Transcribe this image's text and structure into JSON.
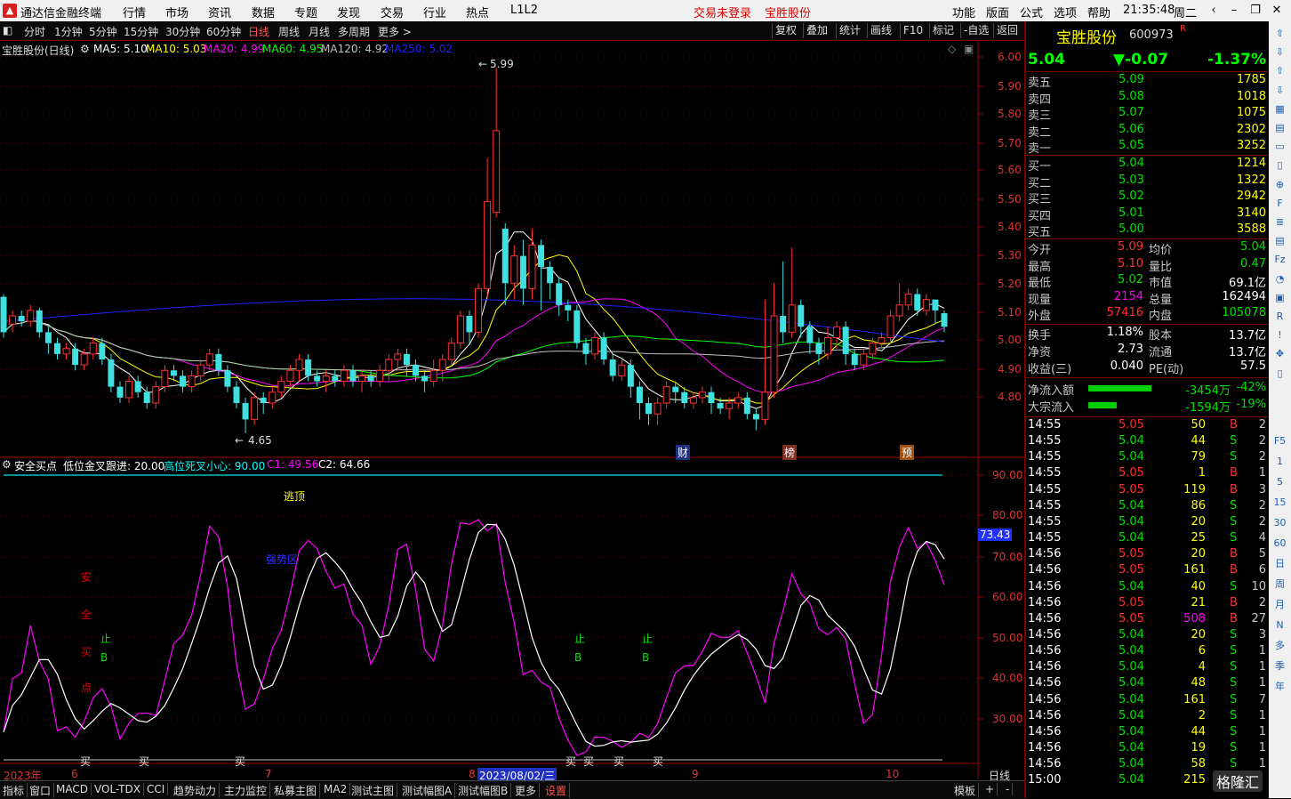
{
  "titlebar": {
    "app": "通达信金融终端",
    "menu": [
      "行情",
      "市场",
      "资讯",
      "数据",
      "专题",
      "发现",
      "交易",
      "行业",
      "热点",
      "L1L2"
    ],
    "status_red": "交易未登录",
    "status_stock": "宝胜股份",
    "right_menu": [
      "功能",
      "版面",
      "公式",
      "选项",
      "帮助"
    ],
    "time": "21:35:48",
    "weekday": "周二"
  },
  "toolbar": {
    "periods": [
      "分时",
      "1分钟",
      "5分钟",
      "15分钟",
      "30分钟",
      "60分钟",
      "日线",
      "周线",
      "月线",
      "多周期",
      "更多 >"
    ],
    "active_period": "日线",
    "right_buttons": [
      "复权",
      "叠加",
      "统计",
      "画线",
      "F10",
      "标记",
      "-自选",
      "返回"
    ]
  },
  "main_chart": {
    "title": "宝胜股份(日线)",
    "ma_legend": [
      {
        "label": "MA5: 5.10",
        "color": "#ffffff"
      },
      {
        "label": "MA10: 5.03",
        "color": "#ffff00"
      },
      {
        "label": "MA20: 4.99",
        "color": "#ff00ff"
      },
      {
        "label": "MA60: 4.95",
        "color": "#00ff00"
      },
      {
        "label": "MA120: 4.92",
        "color": "#c0c0c0"
      },
      {
        "label": "MA250: 5.02",
        "color": "#2020ff"
      }
    ],
    "high_label": "5.99",
    "low_label": "4.65",
    "y_ticks": [
      "6.00",
      "5.90",
      "5.80",
      "5.70",
      "5.60",
      "5.50",
      "5.40",
      "5.30",
      "5.20",
      "5.10",
      "5.00",
      "4.90",
      "4.80"
    ],
    "event_markers": [
      "财",
      "榜",
      "预"
    ]
  },
  "indicator": {
    "name": "安全买点",
    "params": [
      {
        "label": "低位金叉跟进: 20.00",
        "color": "#ffffff"
      },
      {
        "label": "高位死叉小心: 90.00",
        "color": "#00ffff"
      },
      {
        "label": "C1: 49.56",
        "color": "#ff00ff"
      },
      {
        "label": "C2: 64.66",
        "color": "#ffffff"
      }
    ],
    "y_ticks": [
      "90.00",
      "80.00",
      "70.00",
      "60.00",
      "50.00",
      "40.00",
      "30.00"
    ],
    "current_value": "73.43",
    "top_label": "逃顶",
    "blue_label": "强势区",
    "vertical_label": [
      "安",
      "全",
      "买",
      "点"
    ],
    "stop_labels": [
      "止",
      "止",
      "止"
    ],
    "b_label": "B",
    "buy_label": "买"
  },
  "x_axis": {
    "labels": [
      "2023年",
      "6",
      "7",
      "8",
      "2023/08/02/三",
      "9",
      "10"
    ],
    "period_label": "日线"
  },
  "bottom_tabs": [
    "指标",
    "窗口",
    "MACD",
    "VOL-TDX",
    "CCI",
    "趋势动力",
    "主力监控",
    "私募主图",
    "MA2",
    "测试主图",
    "测试幅图A",
    "测试幅图B",
    "更多",
    "设置"
  ],
  "bottom_right": [
    "模板",
    "+",
    "-"
  ],
  "quote": {
    "name": "宝胜股份",
    "code": "600973",
    "suffix": "R",
    "price": "5.04",
    "change": "▼-0.07",
    "change_pct": "-1.37%",
    "asks": [
      {
        "label": "卖五",
        "price": "5.09",
        "vol": "1785"
      },
      {
        "label": "卖四",
        "price": "5.08",
        "vol": "1018"
      },
      {
        "label": "卖三",
        "price": "5.07",
        "vol": "1075"
      },
      {
        "label": "卖二",
        "price": "5.06",
        "vol": "2302"
      },
      {
        "label": "卖一",
        "price": "5.05",
        "vol": "3252"
      }
    ],
    "bids": [
      {
        "label": "买一",
        "price": "5.04",
        "vol": "1214"
      },
      {
        "label": "买二",
        "price": "5.03",
        "vol": "1322"
      },
      {
        "label": "买三",
        "price": "5.02",
        "vol": "2942"
      },
      {
        "label": "买四",
        "price": "5.01",
        "vol": "3140"
      },
      {
        "label": "买五",
        "price": "5.00",
        "vol": "3588"
      }
    ],
    "stats": [
      {
        "l1": "今开",
        "v1": "5.09",
        "c1": "#ff3030",
        "l2": "均价",
        "v2": "5.04",
        "c2": "#00e000"
      },
      {
        "l1": "最高",
        "v1": "5.10",
        "c1": "#ff3030",
        "l2": "量比",
        "v2": "0.47",
        "c2": "#00e000"
      },
      {
        "l1": "最低",
        "v1": "5.02",
        "c1": "#00e000",
        "l2": "市值",
        "v2": "69.1亿",
        "c2": "#ffffff"
      },
      {
        "l1": "现量",
        "v1": "2154",
        "c1": "#ff00ff",
        "l2": "总量",
        "v2": "162494",
        "c2": "#ffffff"
      },
      {
        "l1": "外盘",
        "v1": "57416",
        "c1": "#ff3030",
        "l2": "内盘",
        "v2": "105078",
        "c2": "#00e000"
      }
    ],
    "fin": [
      {
        "l1": "换手",
        "v1": "1.18%",
        "l2": "股本",
        "v2": "13.7亿"
      },
      {
        "l1": "净资",
        "v1": "2.73",
        "l2": "流通",
        "v2": "13.7亿"
      },
      {
        "l1": "收益(三)",
        "v1": "0.040",
        "l2": "PE(动)",
        "v2": "57.5"
      }
    ],
    "flows": [
      {
        "label": "净流入额",
        "value": "-3454万",
        "pct": "-42%",
        "bar": 0.42
      },
      {
        "label": "大宗流入",
        "value": "-1594万",
        "pct": "-19%",
        "bar": 0.19
      }
    ],
    "ticks": [
      {
        "t": "14:55",
        "p": "5.05",
        "v": "50",
        "bs": "B",
        "n": "2"
      },
      {
        "t": "14:55",
        "p": "5.04",
        "v": "44",
        "bs": "S",
        "n": "2"
      },
      {
        "t": "14:55",
        "p": "5.04",
        "v": "79",
        "bs": "S",
        "n": "2"
      },
      {
        "t": "14:55",
        "p": "5.05",
        "v": "1",
        "bs": "B",
        "n": "1"
      },
      {
        "t": "14:55",
        "p": "5.05",
        "v": "119",
        "bs": "B",
        "n": "3"
      },
      {
        "t": "14:55",
        "p": "5.04",
        "v": "86",
        "bs": "S",
        "n": "2"
      },
      {
        "t": "14:55",
        "p": "5.04",
        "v": "20",
        "bs": "S",
        "n": "2"
      },
      {
        "t": "14:55",
        "p": "5.04",
        "v": "25",
        "bs": "S",
        "n": "4"
      },
      {
        "t": "14:56",
        "p": "5.05",
        "v": "20",
        "bs": "B",
        "n": "5"
      },
      {
        "t": "14:56",
        "p": "5.05",
        "v": "161",
        "bs": "B",
        "n": "6"
      },
      {
        "t": "14:56",
        "p": "5.04",
        "v": "40",
        "bs": "S",
        "n": "10"
      },
      {
        "t": "14:56",
        "p": "5.05",
        "v": "21",
        "bs": "B",
        "n": "2"
      },
      {
        "t": "14:56",
        "p": "5.05",
        "v": "508",
        "bs": "B",
        "n": "27"
      },
      {
        "t": "14:56",
        "p": "5.04",
        "v": "20",
        "bs": "S",
        "n": "3"
      },
      {
        "t": "14:56",
        "p": "5.04",
        "v": "6",
        "bs": "S",
        "n": "1"
      },
      {
        "t": "14:56",
        "p": "5.04",
        "v": "4",
        "bs": "S",
        "n": "1"
      },
      {
        "t": "14:56",
        "p": "5.04",
        "v": "48",
        "bs": "S",
        "n": "1"
      },
      {
        "t": "14:56",
        "p": "5.04",
        "v": "161",
        "bs": "S",
        "n": "7"
      },
      {
        "t": "14:56",
        "p": "5.04",
        "v": "2",
        "bs": "S",
        "n": "1"
      },
      {
        "t": "14:56",
        "p": "5.04",
        "v": "44",
        "bs": "S",
        "n": "1"
      },
      {
        "t": "14:56",
        "p": "5.04",
        "v": "19",
        "bs": "S",
        "n": "1"
      },
      {
        "t": "14:56",
        "p": "5.04",
        "v": "58",
        "bs": "S",
        "n": "1"
      },
      {
        "t": "15:00",
        "p": "5.04",
        "v": "215",
        "bs": "",
        "n": ""
      }
    ],
    "watermark": "格隆汇"
  },
  "sidebar_icons": [
    "arrow-up-icon",
    "arrow-down-icon",
    "arrow-up2-icon",
    "arrow-down2-icon",
    "chart-icon",
    "grid-icon",
    "line-icon",
    "candle-icon",
    "zoom-icon",
    "f10-icon",
    "list-icon",
    "book-icon",
    "fz-icon",
    "clock-icon",
    "box-icon",
    "rsi-icon",
    "alert-icon",
    "move-icon",
    "kline-icon"
  ],
  "sidebar_labels": [
    "F5",
    "1",
    "5",
    "15",
    "30",
    "60",
    "日",
    "周",
    "月",
    "N",
    "多",
    "季",
    "年"
  ],
  "chart_data": {
    "type": "candlestick",
    "price_range": [
      4.6,
      6.05
    ],
    "candles": [
      [
        5.15,
        5.02,
        5.16,
        5.0
      ],
      [
        5.05,
        5.08,
        5.1,
        5.02
      ],
      [
        5.08,
        5.06,
        5.1,
        5.04
      ],
      [
        5.06,
        5.1,
        5.12,
        5.04
      ],
      [
        5.1,
        5.02,
        5.11,
        5.0
      ],
      [
        5.02,
        4.98,
        5.04,
        4.94
      ],
      [
        4.98,
        4.94,
        5.0,
        4.92
      ],
      [
        4.94,
        4.96,
        4.98,
        4.92
      ],
      [
        4.96,
        4.9,
        4.98,
        4.88
      ],
      [
        4.9,
        4.94,
        4.96,
        4.88
      ],
      [
        4.94,
        4.98,
        5.0,
        4.92
      ],
      [
        4.98,
        4.92,
        5.0,
        4.9
      ],
      [
        4.92,
        4.82,
        4.94,
        4.8
      ],
      [
        4.82,
        4.78,
        4.84,
        4.76
      ],
      [
        4.78,
        4.84,
        4.86,
        4.76
      ],
      [
        4.84,
        4.8,
        4.86,
        4.78
      ],
      [
        4.8,
        4.76,
        4.82,
        4.74
      ],
      [
        4.76,
        4.82,
        4.84,
        4.74
      ],
      [
        4.82,
        4.88,
        4.9,
        4.8
      ],
      [
        4.88,
        4.86,
        4.9,
        4.84
      ],
      [
        4.86,
        4.82,
        4.88,
        4.8
      ],
      [
        4.82,
        4.86,
        4.88,
        4.8
      ],
      [
        4.86,
        4.9,
        4.92,
        4.84
      ],
      [
        4.9,
        4.94,
        4.96,
        4.88
      ],
      [
        4.94,
        4.88,
        4.96,
        4.86
      ],
      [
        4.88,
        4.82,
        4.9,
        4.8
      ],
      [
        4.82,
        4.76,
        4.84,
        4.74
      ],
      [
        4.76,
        4.7,
        4.78,
        4.65
      ],
      [
        4.7,
        4.78,
        4.8,
        4.68
      ],
      [
        4.78,
        4.76,
        4.8,
        4.72
      ],
      [
        4.76,
        4.8,
        4.82,
        4.74
      ],
      [
        4.8,
        4.84,
        4.86,
        4.78
      ],
      [
        4.84,
        4.88,
        4.9,
        4.82
      ],
      [
        4.88,
        4.92,
        4.94,
        4.84
      ],
      [
        4.92,
        4.86,
        4.94,
        4.84
      ],
      [
        4.86,
        4.84,
        4.88,
        4.82
      ],
      [
        4.84,
        4.86,
        4.88,
        4.8
      ],
      [
        4.86,
        4.84,
        4.88,
        4.82
      ],
      [
        4.84,
        4.88,
        4.9,
        4.82
      ],
      [
        4.88,
        4.84,
        4.9,
        4.82
      ],
      [
        4.84,
        4.86,
        4.88,
        4.8
      ],
      [
        4.86,
        4.84,
        4.88,
        4.82
      ],
      [
        4.84,
        4.88,
        4.9,
        4.82
      ],
      [
        4.88,
        4.92,
        4.94,
        4.84
      ],
      [
        4.92,
        4.94,
        4.96,
        4.88
      ],
      [
        4.94,
        4.9,
        4.96,
        4.86
      ],
      [
        4.9,
        4.86,
        4.92,
        4.84
      ],
      [
        4.86,
        4.84,
        4.88,
        4.8
      ],
      [
        4.84,
        4.88,
        4.92,
        4.82
      ],
      [
        4.88,
        4.92,
        4.94,
        4.84
      ],
      [
        4.92,
        4.98,
        5.0,
        4.9
      ],
      [
        4.98,
        5.08,
        5.1,
        4.96
      ],
      [
        5.08,
        5.02,
        5.1,
        4.98
      ],
      [
        5.02,
        5.18,
        5.2,
        5.0
      ],
      [
        5.18,
        5.5,
        5.66,
        5.15
      ],
      [
        5.46,
        5.76,
        5.99,
        5.44
      ],
      [
        5.4,
        5.2,
        5.42,
        5.12
      ],
      [
        5.2,
        5.3,
        5.34,
        5.14
      ],
      [
        5.3,
        5.18,
        5.36,
        5.12
      ],
      [
        5.18,
        5.34,
        5.4,
        5.14
      ],
      [
        5.34,
        5.26,
        5.36,
        5.1
      ],
      [
        5.26,
        5.2,
        5.28,
        5.14
      ],
      [
        5.2,
        5.12,
        5.22,
        5.08
      ],
      [
        5.12,
        5.1,
        5.14,
        5.06
      ],
      [
        5.1,
        4.98,
        5.12,
        4.96
      ],
      [
        4.98,
        4.94,
        5.0,
        4.9
      ],
      [
        4.94,
        5.0,
        5.02,
        4.92
      ],
      [
        5.0,
        4.92,
        5.02,
        4.9
      ],
      [
        4.92,
        4.86,
        4.94,
        4.84
      ],
      [
        4.86,
        4.9,
        4.92,
        4.84
      ],
      [
        4.9,
        4.82,
        4.92,
        4.78
      ],
      [
        4.82,
        4.76,
        4.84,
        4.7
      ],
      [
        4.76,
        4.72,
        4.78,
        4.68
      ],
      [
        4.72,
        4.76,
        4.78,
        4.68
      ],
      [
        4.76,
        4.82,
        4.84,
        4.74
      ],
      [
        4.82,
        4.8,
        4.84,
        4.76
      ],
      [
        4.8,
        4.76,
        4.82,
        4.74
      ],
      [
        4.76,
        4.78,
        4.8,
        4.74
      ],
      [
        4.78,
        4.8,
        4.82,
        4.76
      ],
      [
        4.8,
        4.76,
        4.82,
        4.72
      ],
      [
        4.76,
        4.74,
        4.78,
        4.72
      ],
      [
        4.74,
        4.76,
        4.78,
        4.7
      ],
      [
        4.76,
        4.78,
        4.8,
        4.74
      ],
      [
        4.78,
        4.72,
        4.8,
        4.7
      ],
      [
        4.72,
        4.7,
        4.74,
        4.66
      ],
      [
        4.7,
        4.8,
        5.14,
        4.68
      ],
      [
        4.8,
        5.08,
        5.2,
        4.78
      ],
      [
        5.08,
        5.02,
        5.28,
        4.98
      ],
      [
        5.02,
        5.12,
        5.33,
        5.0
      ],
      [
        5.12,
        5.04,
        5.14,
        5.0
      ],
      [
        5.04,
        4.98,
        5.06,
        4.94
      ],
      [
        4.98,
        4.94,
        5.0,
        4.9
      ],
      [
        4.94,
        5.0,
        5.04,
        4.92
      ],
      [
        5.0,
        5.04,
        5.06,
        4.96
      ],
      [
        5.04,
        4.94,
        5.06,
        4.9
      ],
      [
        4.94,
        4.9,
        4.96,
        4.88
      ],
      [
        4.9,
        4.94,
        4.96,
        4.88
      ],
      [
        4.94,
        4.98,
        5.0,
        4.92
      ],
      [
        4.98,
        5.0,
        5.02,
        4.96
      ],
      [
        5.0,
        5.08,
        5.1,
        4.98
      ],
      [
        5.08,
        5.12,
        5.2,
        5.06
      ],
      [
        5.12,
        5.16,
        5.18,
        5.1
      ],
      [
        5.16,
        5.1,
        5.18,
        5.08
      ],
      [
        5.1,
        5.14,
        5.16,
        5.08
      ],
      [
        5.14,
        5.1,
        5.12,
        5.05
      ],
      [
        5.09,
        5.04,
        5.1,
        5.02
      ]
    ]
  }
}
